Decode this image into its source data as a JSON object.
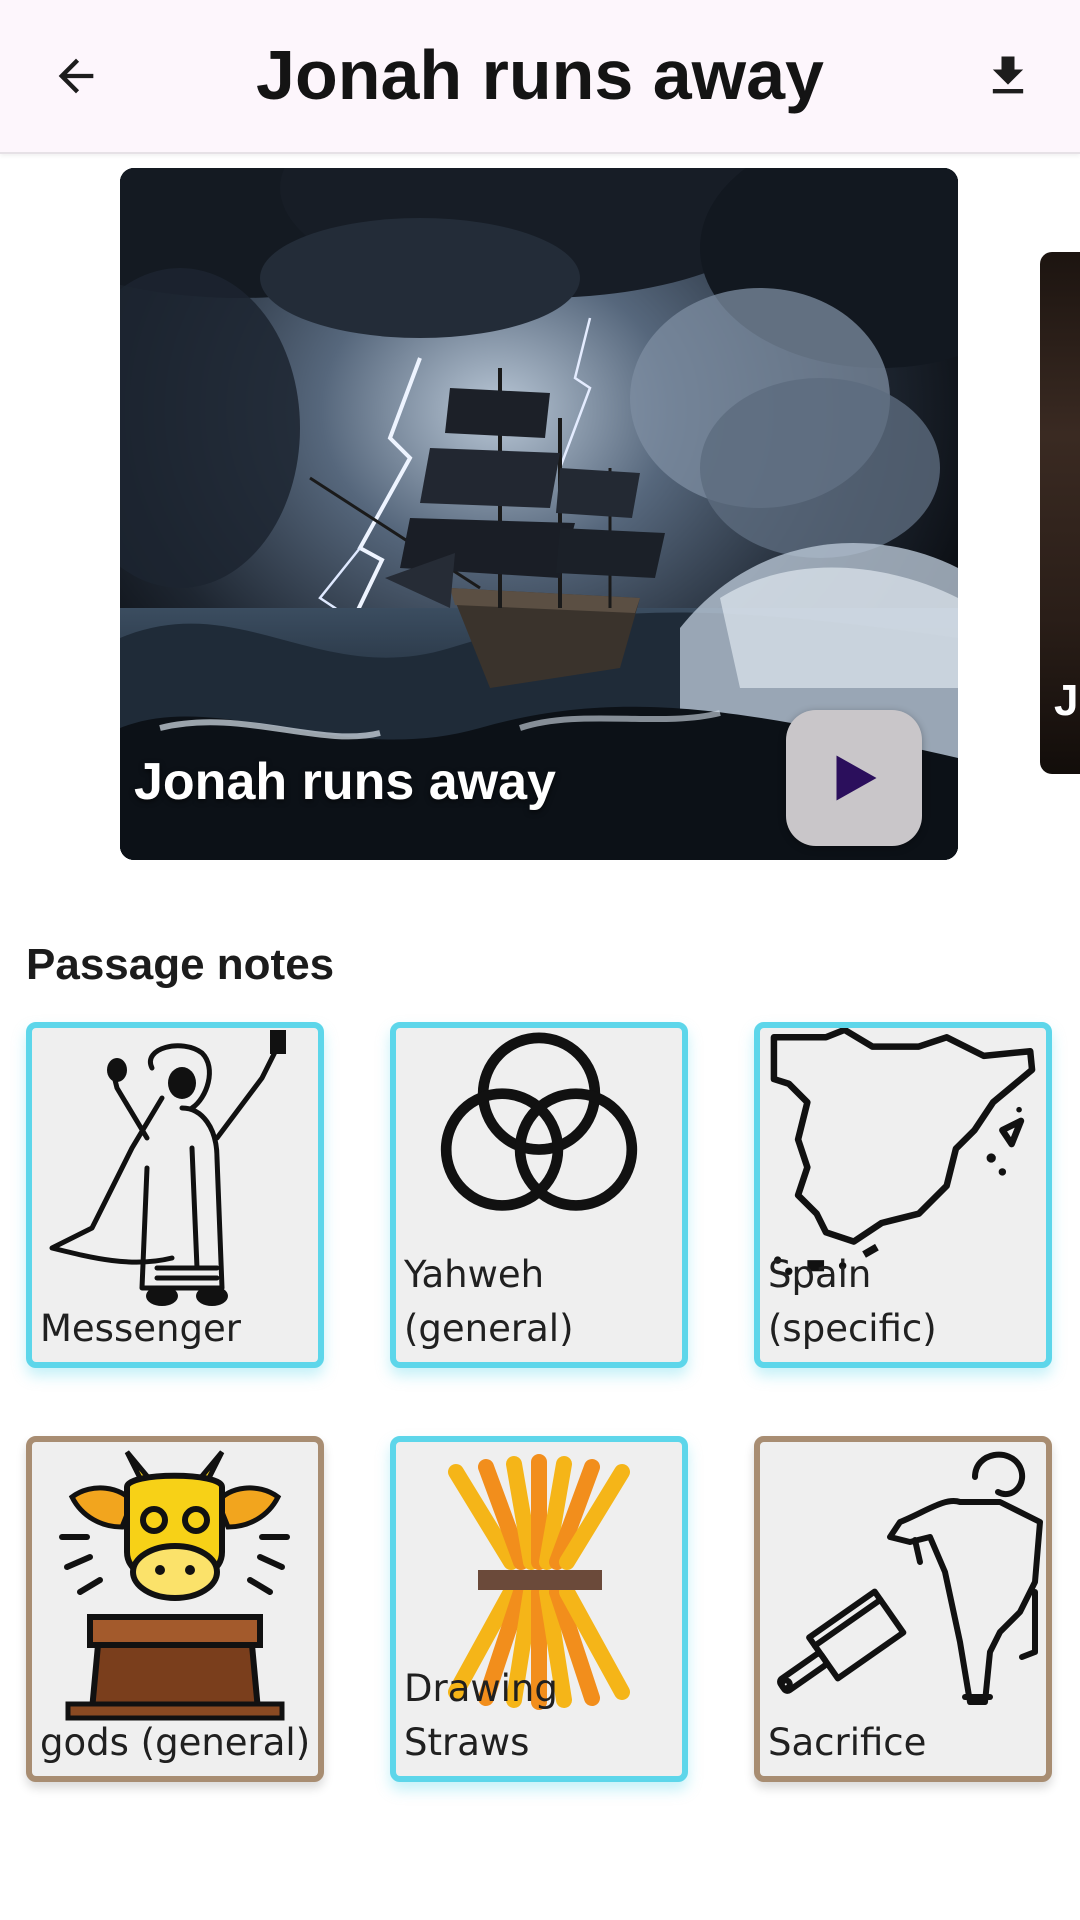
{
  "app_bar": {
    "title": "Jonah runs away",
    "back_icon": "arrow-left-icon",
    "download_icon": "download-icon"
  },
  "carousel": {
    "current_slide": {
      "title": "Jonah runs away",
      "image": "stormy-sea-ship-image",
      "play_icon": "play-icon"
    },
    "next_slide_peek": "J"
  },
  "passage_notes": {
    "heading": "Passage notes",
    "items": [
      {
        "label": "Messenger",
        "icon": "messenger-icon",
        "border": "#5dd6ea"
      },
      {
        "label": "Yahweh (general)",
        "icon": "trinity-rings-icon",
        "border": "#5dd6ea"
      },
      {
        "label": "Spain (specific)",
        "icon": "spain-map-icon",
        "border": "#5dd6ea"
      },
      {
        "label": "gods (general)",
        "icon": "golden-calf-icon",
        "border": "#a88d72"
      },
      {
        "label": "Drawing Straws",
        "icon": "straws-icon",
        "border": "#5dd6ea"
      },
      {
        "label": "Sacrifice",
        "icon": "goat-cleaver-icon",
        "border": "#a88d72"
      }
    ]
  },
  "colors": {
    "app_bar_bg": "#fdf6fc",
    "cyan_border": "#5dd6ea",
    "brown_border": "#a88d72",
    "play_triangle": "#2b0f5c"
  }
}
